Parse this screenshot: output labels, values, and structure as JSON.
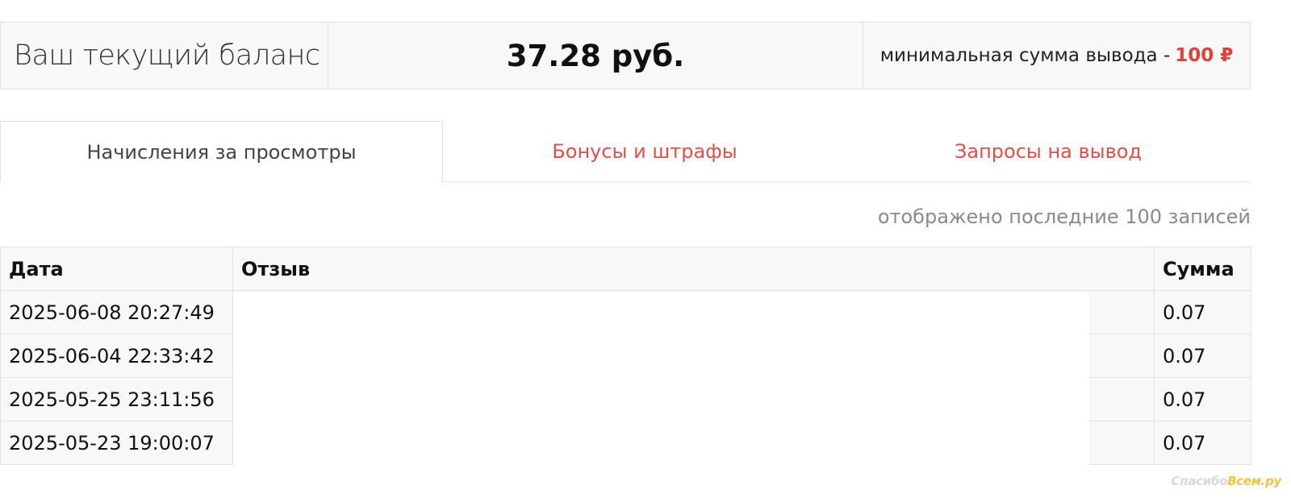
{
  "balance": {
    "label": "Ваш текущий баланс",
    "amount": "37.28 руб.",
    "min_label": "минимальная сумма вывода -",
    "min_value": "100 ₽"
  },
  "tabs": [
    {
      "label": "Начисления за просмотры",
      "active": true
    },
    {
      "label": "Бонусы и штрафы",
      "active": false
    },
    {
      "label": "Запросы на вывод",
      "active": false
    }
  ],
  "records_note": "отображено последние 100 записей",
  "table": {
    "headers": {
      "date": "Дата",
      "review": "Отзыв",
      "sum": "Сумма"
    },
    "rows": [
      {
        "date": "2025-06-08 20:27:49",
        "review": "",
        "sum": "0.07"
      },
      {
        "date": "2025-06-04 22:33:42",
        "review": "",
        "sum": "0.07"
      },
      {
        "date": "2025-05-25 23:11:56",
        "review": "",
        "sum": "0.07"
      },
      {
        "date": "2025-05-23 19:00:07",
        "review": "",
        "sum": "0.07"
      }
    ]
  },
  "watermark": {
    "text_a": "Спасибо",
    "text_b": "Всем.ру"
  },
  "colors": {
    "accent": "#e0504a",
    "border": "#e2e2e2",
    "panel_bg": "#f8f8f8"
  }
}
